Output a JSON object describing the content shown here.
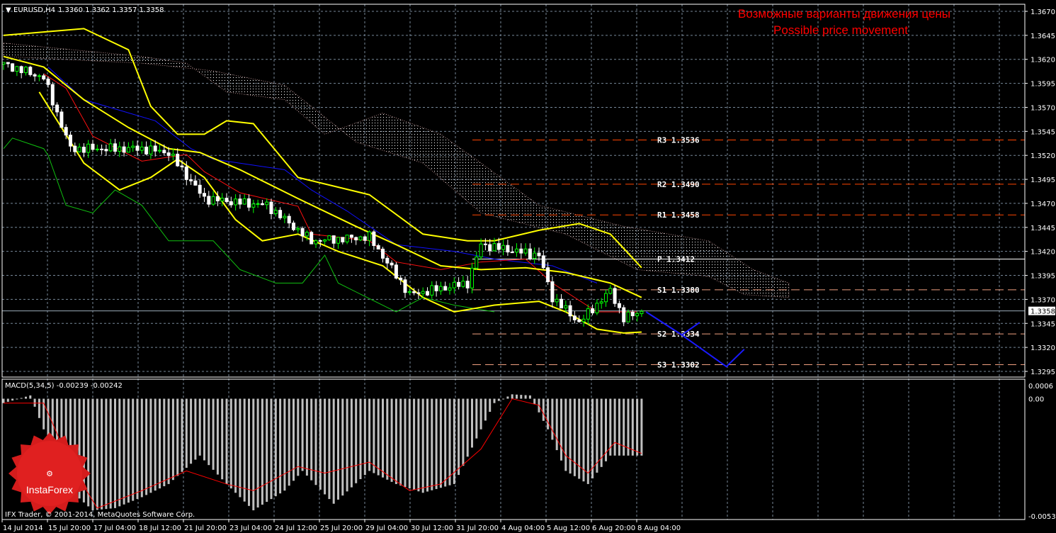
{
  "header": {
    "symbol": "EURUSD,H4",
    "ohlc": "1.3360 1.3362 1.3357 1.3358"
  },
  "annotation": {
    "line1": "Возможные варианты движения цены",
    "line2": "Possible price movement"
  },
  "macd_label": "MACD(5,34,5) -0.00239 -0.00242",
  "copyright": "IFX Trader, © 2001-2014, MetaQuotes Software Corp.",
  "logo_text": "InstaForex",
  "colors": {
    "bg": "#000000",
    "grid": "#778899",
    "bull": "#00ff00",
    "bear": "#ffffff",
    "band": "#ffff00",
    "tenkan": "#ff0000",
    "kijun": "#0000ff",
    "chikou": "#00c000",
    "pivot": "#ff4500",
    "forecast": "#0000ff",
    "annotation": "#ff0000"
  },
  "chart_data": {
    "type": "candlestick",
    "symbol": "EURUSD",
    "timeframe": "H4",
    "ylim": [
      1.3295,
      1.367
    ],
    "price_ticks": [
      "1.3670",
      "1.3645",
      "1.3620",
      "1.3595",
      "1.3570",
      "1.3545",
      "1.3520",
      "1.3495",
      "1.3470",
      "1.3445",
      "1.3420",
      "1.3395",
      "1.3370",
      "1.3345",
      "1.3320",
      "1.3295"
    ],
    "current_price": "1.3358",
    "time_labels": [
      "14 Jul 2014",
      "15 Jul 20:00",
      "17 Jul 04:00",
      "18 Jul 12:00",
      "21 Jul 20:00",
      "23 Jul 04:00",
      "24 Jul 12:00",
      "25 Jul 20:00",
      "29 Jul 04:00",
      "30 Jul 12:00",
      "31 Jul 20:00",
      "4 Aug 04:00",
      "5 Aug 12:00",
      "6 Aug 20:00",
      "8 Aug 04:00"
    ],
    "bar_count": 144,
    "close_path": [
      [
        0,
        1.3615
      ],
      [
        9,
        1.3601
      ],
      [
        15,
        1.3527
      ],
      [
        31,
        1.3527
      ],
      [
        37,
        1.3523
      ],
      [
        45,
        1.3475
      ],
      [
        59,
        1.3468
      ],
      [
        69,
        1.3431
      ],
      [
        82,
        1.3435
      ],
      [
        91,
        1.3375
      ],
      [
        104,
        1.3387
      ],
      [
        107,
        1.3427
      ],
      [
        120,
        1.3416
      ],
      [
        123,
        1.3372
      ],
      [
        129,
        1.3346
      ],
      [
        136,
        1.3379
      ],
      [
        139,
        1.335
      ],
      [
        143,
        1.3358
      ]
    ],
    "bollinger_upper": [
      [
        0,
        1.3645
      ],
      [
        18,
        1.3652
      ],
      [
        28,
        1.363
      ],
      [
        33,
        1.3571
      ],
      [
        39,
        1.3542
      ],
      [
        45,
        1.3542
      ],
      [
        50,
        1.3556
      ],
      [
        56,
        1.3553
      ],
      [
        66,
        1.3497
      ],
      [
        82,
        1.3479
      ],
      [
        94,
        1.3438
      ],
      [
        104,
        1.3431
      ],
      [
        110,
        1.3431
      ],
      [
        120,
        1.3442
      ],
      [
        129,
        1.3449
      ],
      [
        136,
        1.3438
      ],
      [
        143,
        1.3403
      ]
    ],
    "bollinger_middle": [
      [
        0,
        1.3623
      ],
      [
        9,
        1.3612
      ],
      [
        18,
        1.3578
      ],
      [
        28,
        1.3549
      ],
      [
        37,
        1.3527
      ],
      [
        44,
        1.3523
      ],
      [
        53,
        1.3505
      ],
      [
        66,
        1.3475
      ],
      [
        79,
        1.3446
      ],
      [
        88,
        1.3427
      ],
      [
        98,
        1.3405
      ],
      [
        107,
        1.3401
      ],
      [
        117,
        1.3403
      ],
      [
        126,
        1.3398
      ],
      [
        136,
        1.3387
      ],
      [
        143,
        1.3372
      ]
    ],
    "bollinger_lower": [
      [
        8,
        1.3586
      ],
      [
        18,
        1.3512
      ],
      [
        26,
        1.3484
      ],
      [
        33,
        1.3497
      ],
      [
        39,
        1.3516
      ],
      [
        45,
        1.3497
      ],
      [
        52,
        1.3453
      ],
      [
        58,
        1.3431
      ],
      [
        66,
        1.3438
      ],
      [
        75,
        1.342
      ],
      [
        85,
        1.3405
      ],
      [
        94,
        1.3372
      ],
      [
        101,
        1.3357
      ],
      [
        110,
        1.3364
      ],
      [
        120,
        1.3368
      ],
      [
        126,
        1.3357
      ],
      [
        133,
        1.3339
      ],
      [
        139,
        1.3335
      ],
      [
        143,
        1.3336
      ]
    ],
    "tenkan": [
      [
        9,
        1.3605
      ],
      [
        14,
        1.359
      ],
      [
        20,
        1.354
      ],
      [
        31,
        1.3514
      ],
      [
        41,
        1.3521
      ],
      [
        45,
        1.3503
      ],
      [
        53,
        1.3481
      ],
      [
        66,
        1.3467
      ],
      [
        69,
        1.3438
      ],
      [
        82,
        1.3431
      ],
      [
        88,
        1.3409
      ],
      [
        98,
        1.3401
      ],
      [
        107,
        1.3409
      ],
      [
        117,
        1.3412
      ],
      [
        123,
        1.3387
      ],
      [
        133,
        1.3357
      ],
      [
        142,
        1.3357
      ]
    ],
    "kijun": [
      [
        10,
        1.3612
      ],
      [
        18,
        1.3578
      ],
      [
        34,
        1.3556
      ],
      [
        42,
        1.3527
      ],
      [
        47,
        1.3516
      ],
      [
        63,
        1.3505
      ],
      [
        69,
        1.3484
      ],
      [
        77,
        1.3462
      ],
      [
        88,
        1.3427
      ],
      [
        101,
        1.342
      ],
      [
        110,
        1.3412
      ],
      [
        123,
        1.3405
      ],
      [
        133,
        1.3387
      ]
    ],
    "chikou": [
      [
        0,
        1.3527
      ],
      [
        2,
        1.3538
      ],
      [
        9,
        1.3527
      ],
      [
        10,
        1.352
      ],
      [
        14,
        1.3468
      ],
      [
        20,
        1.346
      ],
      [
        25,
        1.3484
      ],
      [
        31,
        1.3468
      ],
      [
        37,
        1.3431
      ],
      [
        47,
        1.3431
      ],
      [
        53,
        1.3401
      ],
      [
        61,
        1.3387
      ],
      [
        67,
        1.3387
      ],
      [
        72,
        1.3416
      ],
      [
        75,
        1.3387
      ],
      [
        88,
        1.3357
      ],
      [
        94,
        1.3372
      ],
      [
        101,
        1.3364
      ],
      [
        110,
        1.3357
      ]
    ],
    "cloud_span_a": [
      [
        0,
        1.3637
      ],
      [
        31,
        1.3623
      ],
      [
        41,
        1.3616
      ],
      [
        50,
        1.3586
      ],
      [
        63,
        1.3578
      ],
      [
        72,
        1.3542
      ],
      [
        85,
        1.3564
      ],
      [
        98,
        1.3542
      ],
      [
        107,
        1.3512
      ],
      [
        120,
        1.3468
      ],
      [
        139,
        1.3446
      ],
      [
        158,
        1.3431
      ],
      [
        168,
        1.3401
      ],
      [
        176,
        1.3387
      ]
    ],
    "cloud_span_b": [
      [
        0,
        1.3623
      ],
      [
        31,
        1.3616
      ],
      [
        47,
        1.3608
      ],
      [
        63,
        1.3593
      ],
      [
        79,
        1.3534
      ],
      [
        94,
        1.3512
      ],
      [
        107,
        1.346
      ],
      [
        126,
        1.3438
      ],
      [
        142,
        1.3401
      ],
      [
        158,
        1.3394
      ],
      [
        166,
        1.3375
      ],
      [
        176,
        1.3372
      ]
    ],
    "pivots": [
      {
        "name": "R3",
        "value": "1.3536"
      },
      {
        "name": "R2",
        "value": "1.3490"
      },
      {
        "name": "R1",
        "value": "1.3458"
      },
      {
        "name": "P",
        "value": "1.3412"
      },
      {
        "name": "S1",
        "value": "1.3380"
      },
      {
        "name": "S2",
        "value": "1.3334"
      },
      {
        "name": "S3",
        "value": "1.3302"
      }
    ],
    "forecast_paths": [
      [
        [
          144,
          1.3357
        ],
        [
          152,
          1.3333
        ],
        [
          156,
          1.3346
        ]
      ],
      [
        [
          152,
          1.3333
        ],
        [
          162,
          1.33
        ],
        [
          166,
          1.3318
        ]
      ]
    ],
    "macd": {
      "ylim": [
        -0.00536,
        0.0006
      ],
      "ticks": [
        "0.0006",
        "0.00",
        "-0.00536"
      ],
      "histogram_path": [
        [
          0,
          -0.0002
        ],
        [
          6,
          0.00015
        ],
        [
          9,
          -0.0014
        ],
        [
          15,
          -0.0042
        ],
        [
          20,
          -0.0051
        ],
        [
          25,
          -0.005
        ],
        [
          31,
          -0.0045
        ],
        [
          37,
          -0.0039
        ],
        [
          44,
          -0.0026
        ],
        [
          50,
          -0.0039
        ],
        [
          56,
          -0.0051
        ],
        [
          63,
          -0.0042
        ],
        [
          67,
          -0.0033
        ],
        [
          74,
          -0.0048
        ],
        [
          82,
          -0.0033
        ],
        [
          88,
          -0.0039
        ],
        [
          94,
          -0.0043
        ],
        [
          101,
          -0.0039
        ],
        [
          107,
          -0.0014
        ],
        [
          110,
          -0.0002
        ],
        [
          114,
          0.0002
        ],
        [
          118,
          0.00015
        ],
        [
          122,
          -0.0014
        ],
        [
          126,
          -0.0033
        ],
        [
          131,
          -0.0039
        ],
        [
          136,
          -0.0026
        ],
        [
          143,
          -0.0026
        ]
      ],
      "signal_path": [
        [
          0,
          -0.0002
        ],
        [
          9,
          -0.0002
        ],
        [
          15,
          -0.003
        ],
        [
          21,
          -0.005
        ],
        [
          31,
          -0.0042
        ],
        [
          41,
          -0.0033
        ],
        [
          50,
          -0.0039
        ],
        [
          56,
          -0.0042
        ],
        [
          66,
          -0.0031
        ],
        [
          72,
          -0.0034
        ],
        [
          82,
          -0.0029
        ],
        [
          91,
          -0.0042
        ],
        [
          98,
          -0.0039
        ],
        [
          107,
          -0.0023
        ],
        [
          114,
          0.0
        ],
        [
          120,
          -0.0003
        ],
        [
          126,
          -0.0026
        ],
        [
          131,
          -0.0034
        ],
        [
          137,
          -0.002
        ],
        [
          143,
          -0.0025
        ]
      ]
    }
  }
}
